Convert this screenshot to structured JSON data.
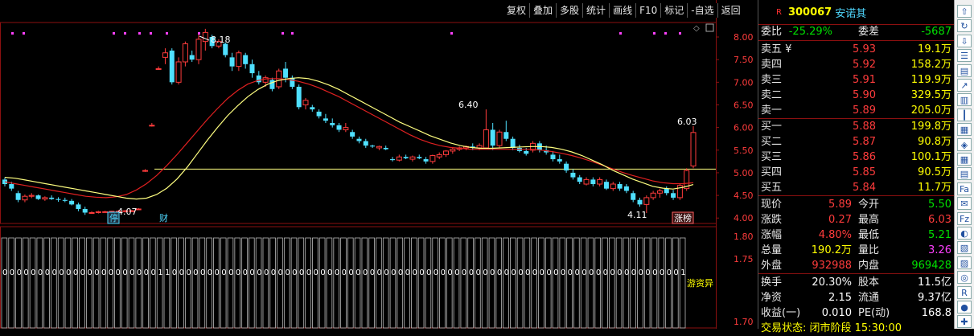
{
  "toolbar": [
    "复权",
    "叠加",
    "多股",
    "统计",
    "画线",
    "F10",
    "标记",
    "-自选",
    "返回"
  ],
  "chart": {
    "price_axis": [
      "8.00",
      "7.50",
      "7.00",
      "6.50",
      "6.00",
      "5.50",
      "5.00",
      "4.50",
      "4.00"
    ],
    "volume_axis": [
      "1.80",
      "1.75",
      "1.70"
    ],
    "annotations": {
      "high": "8.18",
      "low": "4.07",
      "peak2": "6.40",
      "low2": "4.11",
      "last_high": "6.03"
    },
    "tags": {
      "ting": "停",
      "cai": "财",
      "zhangting": "涨榜",
      "youzi": "游资异"
    },
    "zero_one_digits": "0000000000000000000000110000000000000000000000000000000000000000000000000000000000000000000000001"
  },
  "chart_data": {
    "type": "candlestick",
    "candles": [
      [
        4.85,
        4.9,
        4.7,
        4.75
      ],
      [
        4.75,
        4.8,
        4.6,
        4.65
      ],
      [
        4.55,
        4.6,
        4.35,
        4.4
      ],
      [
        4.4,
        4.52,
        4.35,
        4.48
      ],
      [
        4.48,
        4.55,
        4.44,
        4.5
      ],
      [
        4.5,
        4.52,
        4.4,
        4.42
      ],
      [
        4.42,
        4.48,
        4.38,
        4.45
      ],
      [
        4.45,
        4.5,
        4.4,
        4.42
      ],
      [
        4.42,
        4.46,
        4.36,
        4.4
      ],
      [
        4.4,
        4.45,
        4.35,
        4.38
      ],
      [
        4.38,
        4.42,
        4.28,
        4.3
      ],
      [
        4.3,
        4.34,
        4.15,
        4.2
      ],
      [
        4.2,
        4.25,
        4.07,
        4.12
      ],
      [
        4.12,
        4.15,
        4.1,
        4.12
      ],
      [
        4.12,
        4.16,
        4.1,
        4.14
      ],
      [
        4.14,
        4.16,
        4.12,
        4.14
      ],
      [
        4.14,
        4.16,
        4.12,
        4.15
      ],
      [
        4.15,
        4.18,
        4.12,
        4.15
      ],
      [
        4.15,
        4.18,
        4.12,
        4.16
      ],
      [
        4.16,
        4.18,
        4.14,
        4.16
      ],
      [
        4.2,
        4.22,
        4.18,
        4.2
      ],
      [
        5.05,
        5.08,
        5.02,
        5.05
      ],
      [
        6.05,
        6.1,
        6.02,
        6.05
      ],
      [
        7.3,
        7.35,
        7.28,
        7.3
      ],
      [
        7.55,
        7.75,
        7.4,
        7.65
      ],
      [
        7.7,
        7.75,
        6.95,
        7.0
      ],
      [
        7.0,
        7.55,
        6.95,
        7.45
      ],
      [
        7.45,
        7.9,
        7.35,
        7.85
      ],
      [
        7.6,
        7.7,
        7.45,
        7.5
      ],
      [
        7.5,
        8.05,
        7.4,
        7.95
      ],
      [
        7.9,
        8.18,
        7.7,
        8.1
      ],
      [
        8.0,
        8.05,
        7.75,
        7.8
      ],
      [
        7.8,
        7.95,
        7.75,
        7.9
      ],
      [
        7.85,
        7.88,
        7.55,
        7.6
      ],
      [
        7.55,
        7.65,
        7.25,
        7.35
      ],
      [
        7.35,
        7.7,
        7.25,
        7.65
      ],
      [
        7.6,
        7.65,
        7.3,
        7.4
      ],
      [
        7.4,
        7.5,
        7.1,
        7.2
      ],
      [
        7.15,
        7.25,
        6.95,
        7.0
      ],
      [
        7.0,
        7.15,
        6.9,
        7.1
      ],
      [
        7.05,
        7.1,
        6.8,
        6.85
      ],
      [
        6.9,
        7.3,
        6.85,
        7.25
      ],
      [
        7.3,
        7.45,
        7.0,
        7.1
      ],
      [
        7.1,
        7.15,
        6.85,
        6.9
      ],
      [
        6.9,
        6.95,
        6.4,
        6.45
      ],
      [
        6.5,
        6.65,
        6.4,
        6.6
      ],
      [
        6.45,
        6.5,
        6.35,
        6.4
      ],
      [
        6.35,
        6.4,
        6.2,
        6.25
      ],
      [
        6.2,
        6.3,
        6.1,
        6.15
      ],
      [
        6.1,
        6.2,
        6.0,
        6.05
      ],
      [
        6.05,
        6.1,
        5.9,
        5.95
      ],
      [
        5.95,
        6.1,
        5.9,
        6.0
      ],
      [
        5.9,
        5.95,
        5.75,
        5.8
      ],
      [
        5.75,
        5.8,
        5.65,
        5.7
      ],
      [
        5.7,
        5.75,
        5.55,
        5.6
      ],
      [
        5.6,
        5.62,
        5.55,
        5.58
      ],
      [
        5.55,
        5.6,
        5.5,
        5.58
      ],
      [
        5.55,
        5.6,
        5.5,
        5.52
      ],
      [
        5.3,
        5.35,
        5.25,
        5.28
      ],
      [
        5.28,
        5.4,
        5.25,
        5.35
      ],
      [
        5.35,
        5.4,
        5.3,
        5.32
      ],
      [
        5.3,
        5.38,
        5.25,
        5.35
      ],
      [
        5.35,
        5.4,
        5.3,
        5.32
      ],
      [
        5.3,
        5.35,
        5.2,
        5.25
      ],
      [
        5.25,
        5.4,
        5.2,
        5.38
      ],
      [
        5.35,
        5.45,
        5.3,
        5.4
      ],
      [
        5.4,
        5.5,
        5.35,
        5.48
      ],
      [
        5.48,
        5.55,
        5.42,
        5.52
      ],
      [
        5.52,
        5.58,
        5.48,
        5.55
      ],
      [
        5.55,
        5.6,
        5.5,
        5.58
      ],
      [
        5.58,
        5.65,
        5.5,
        5.55
      ],
      [
        5.55,
        5.65,
        5.5,
        5.6
      ],
      [
        5.55,
        6.4,
        5.55,
        5.95
      ],
      [
        5.95,
        6.1,
        5.5,
        5.6
      ],
      [
        5.6,
        5.95,
        5.55,
        5.9
      ],
      [
        5.9,
        6.15,
        5.7,
        5.75
      ],
      [
        5.75,
        5.8,
        5.5,
        5.55
      ],
      [
        5.55,
        5.62,
        5.45,
        5.48
      ],
      [
        5.48,
        5.55,
        5.38,
        5.42
      ],
      [
        5.5,
        5.7,
        5.45,
        5.65
      ],
      [
        5.65,
        5.7,
        5.45,
        5.5
      ],
      [
        5.5,
        5.6,
        5.4,
        5.45
      ],
      [
        5.4,
        5.48,
        5.25,
        5.3
      ],
      [
        5.3,
        5.4,
        5.2,
        5.25
      ],
      [
        5.2,
        5.25,
        5.0,
        5.05
      ],
      [
        5.0,
        5.08,
        4.85,
        4.9
      ],
      [
        4.9,
        4.95,
        4.75,
        4.8
      ],
      [
        4.75,
        4.9,
        4.72,
        4.85
      ],
      [
        4.85,
        4.9,
        4.7,
        4.75
      ],
      [
        4.75,
        4.9,
        4.7,
        4.85
      ],
      [
        4.8,
        4.85,
        4.62,
        4.65
      ],
      [
        4.65,
        4.8,
        4.6,
        4.75
      ],
      [
        4.75,
        4.8,
        4.6,
        4.65
      ],
      [
        4.7,
        4.75,
        4.55,
        4.6
      ],
      [
        4.55,
        4.6,
        4.35,
        4.4
      ],
      [
        4.4,
        4.45,
        4.25,
        4.3
      ],
      [
        4.3,
        4.5,
        4.11,
        4.45
      ],
      [
        4.45,
        4.6,
        4.4,
        4.55
      ],
      [
        4.55,
        4.65,
        4.45,
        4.6
      ],
      [
        4.65,
        4.7,
        4.5,
        4.55
      ],
      [
        4.55,
        4.62,
        4.4,
        4.45
      ],
      [
        4.45,
        4.75,
        4.4,
        4.72
      ],
      [
        4.65,
        5.1,
        4.6,
        5.05
      ],
      [
        5.15,
        6.03,
        5.1,
        5.89
      ]
    ],
    "ma_short": [
      4.9,
      4.88,
      4.84,
      4.8,
      4.76,
      4.72,
      4.68,
      4.64,
      4.6,
      4.56,
      4.52,
      4.48,
      4.44,
      4.42,
      4.44,
      4.52,
      4.66,
      4.86,
      5.12,
      5.42,
      5.72,
      6.0,
      6.26,
      6.48,
      6.68,
      6.84,
      6.96,
      7.04,
      7.08,
      7.1,
      7.08,
      7.02,
      6.94,
      6.84,
      6.72,
      6.6,
      6.48,
      6.36,
      6.24,
      6.12,
      6.02,
      5.92,
      5.82,
      5.74,
      5.66,
      5.6,
      5.56,
      5.54,
      5.54,
      5.55,
      5.56,
      5.57,
      5.58,
      5.58,
      5.56,
      5.52,
      5.46,
      5.38,
      5.28,
      5.18,
      5.06,
      4.96,
      4.86,
      4.78,
      4.7,
      4.66,
      4.64,
      4.68,
      4.74
    ],
    "ma_long": [
      4.8,
      4.76,
      4.72,
      4.68,
      4.64,
      4.6,
      4.56,
      4.52,
      4.48,
      4.46,
      4.45,
      4.47,
      4.52,
      4.62,
      4.76,
      4.94,
      5.16,
      5.4,
      5.66,
      5.92,
      6.18,
      6.42,
      6.64,
      6.82,
      6.96,
      7.04,
      7.08,
      7.08,
      7.06,
      7.02,
      6.96,
      6.88,
      6.78,
      6.68,
      6.56,
      6.44,
      6.32,
      6.2,
      6.08,
      5.96,
      5.84,
      5.74,
      5.66,
      5.6,
      5.56,
      5.54,
      5.52,
      5.52,
      5.52,
      5.52,
      5.52,
      5.52,
      5.52,
      5.5,
      5.47,
      5.43,
      5.38,
      5.32,
      5.25,
      5.17,
      5.09,
      5.01,
      4.94,
      4.88,
      4.82,
      4.78,
      4.76,
      4.76,
      4.78
    ],
    "ylim": [
      3.9,
      8.3
    ]
  },
  "quote": {
    "r_mark": "R",
    "code": "300067",
    "name": "安诺其",
    "weibi_label": "委比",
    "weibi": "-25.29%",
    "weicha_label": "委差",
    "weicha": "-5687",
    "asks": [
      {
        "label": "卖五 ¥",
        "price": "5.93",
        "vol": "19.1万"
      },
      {
        "label": "卖四",
        "price": "5.92",
        "vol": "158.2万"
      },
      {
        "label": "卖三",
        "price": "5.91",
        "vol": "119.9万"
      },
      {
        "label": "卖二",
        "price": "5.90",
        "vol": "329.5万"
      },
      {
        "label": "卖一",
        "price": "5.89",
        "vol": "205.0万"
      }
    ],
    "bids": [
      {
        "label": "买一",
        "price": "5.88",
        "vol": "199.8万"
      },
      {
        "label": "买二",
        "price": "5.87",
        "vol": "90.8万"
      },
      {
        "label": "买三",
        "price": "5.86",
        "vol": "100.1万"
      },
      {
        "label": "买四",
        "price": "5.85",
        "vol": "90.5万"
      },
      {
        "label": "买五",
        "price": "5.84",
        "vol": "11.7万"
      }
    ],
    "stats": [
      {
        "l1": "现价",
        "v1": "5.89",
        "c1": "red",
        "l2": "今开",
        "v2": "5.50",
        "c2": "green"
      },
      {
        "l1": "涨跌",
        "v1": "0.27",
        "c1": "red",
        "l2": "最高",
        "v2": "6.03",
        "c2": "red"
      },
      {
        "l1": "涨幅",
        "v1": "4.80%",
        "c1": "red",
        "l2": "最低",
        "v2": "5.21",
        "c2": "green"
      },
      {
        "l1": "总量",
        "v1": "190.2万",
        "c1": "yellow",
        "l2": "量比",
        "v2": "3.26",
        "c2": "magenta"
      },
      {
        "l1": "外盘",
        "v1": "932988",
        "c1": "red",
        "l2": "内盘",
        "v2": "969428",
        "c2": "green"
      }
    ],
    "stats2": [
      {
        "l1": "换手",
        "v1": "20.30%",
        "l2": "股本",
        "v2": "11.5亿"
      },
      {
        "l1": "净资",
        "v1": "2.15",
        "l2": "流通",
        "v2": "9.37亿"
      },
      {
        "l1": "收益(一)",
        "v1": "0.010",
        "l2": "PE(动)",
        "v2": "168.8"
      }
    ],
    "footer": "交易状态: 闭市阶段  15:30:00"
  },
  "sidebar_icons": [
    "up-arrow",
    "refresh",
    "down-arrow",
    "list",
    "bar",
    "trend",
    "kline",
    "candle",
    "table",
    "shield",
    "grid",
    "grid2",
    "fa",
    "news",
    "fiz",
    "chart-a",
    "chart-b",
    "chart-c",
    "circle",
    "rsi",
    "dot",
    "plus"
  ]
}
